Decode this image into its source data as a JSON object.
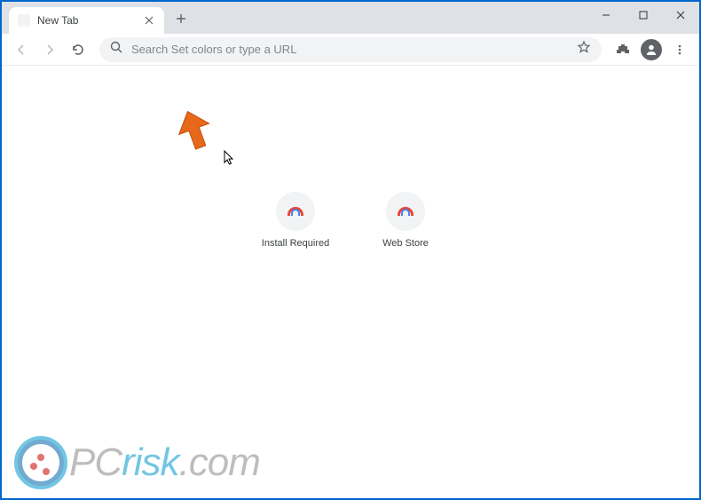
{
  "window": {
    "tab_title": "New Tab"
  },
  "toolbar": {
    "omnibox_placeholder": "Search Set colors or type a URL"
  },
  "shortcuts": [
    {
      "label": "Install Required"
    },
    {
      "label": "Web Store"
    }
  ],
  "watermark": {
    "part1": "PC",
    "part2": "risk",
    "part3": ".com"
  }
}
